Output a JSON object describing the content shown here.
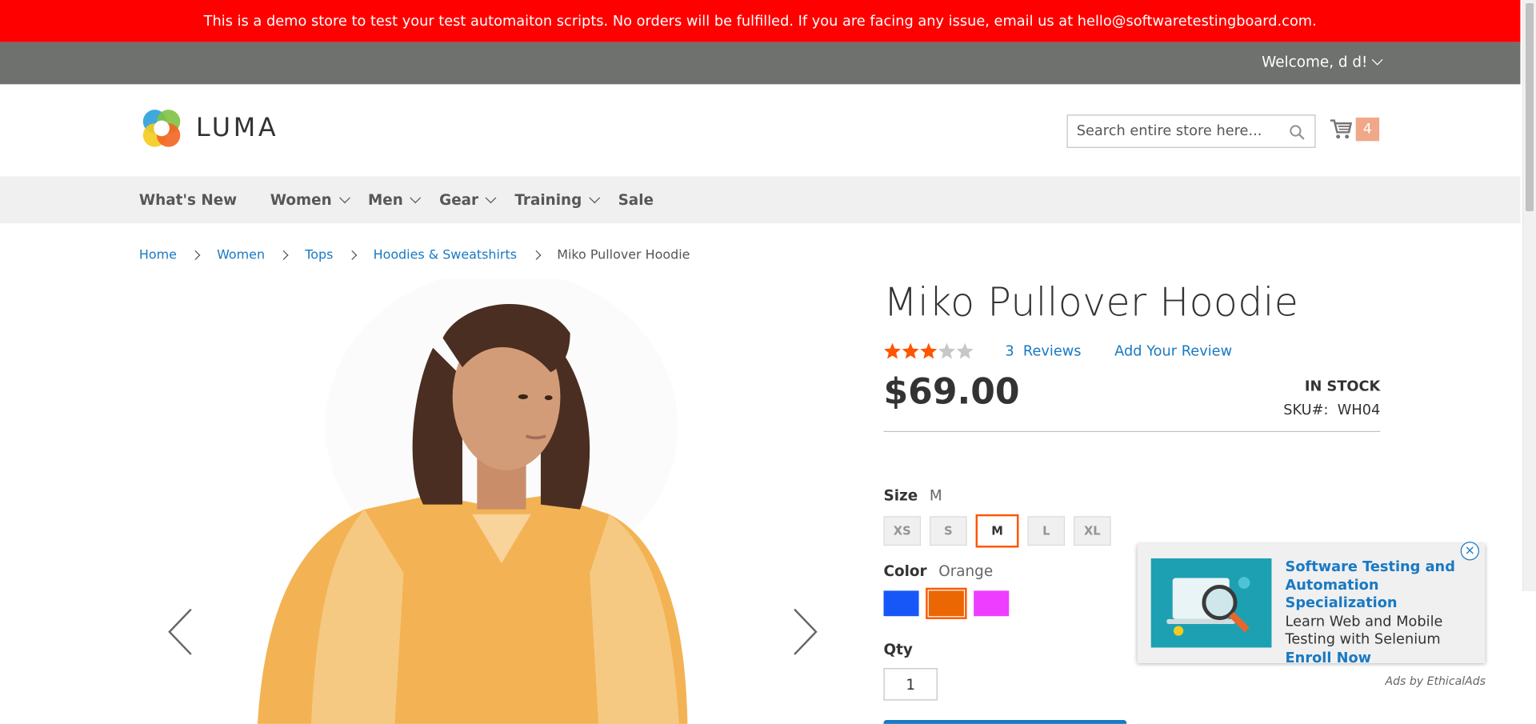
{
  "demo_notice": "This is a demo store to test your test automaiton scripts. No orders will be fulfilled. If you are facing any issue, email us at hello@softwaretestingboard.com.",
  "header": {
    "welcome": "Welcome, d d!",
    "logo_text": "LUMA",
    "search_placeholder": "Search entire store here...",
    "cart_count": "4"
  },
  "nav": {
    "items": [
      {
        "label": "What's New"
      },
      {
        "label": "Women"
      },
      {
        "label": "Men"
      },
      {
        "label": "Gear"
      },
      {
        "label": "Training"
      },
      {
        "label": "Sale"
      }
    ]
  },
  "breadcrumbs": [
    "Home",
    "Women",
    "Tops",
    "Hoodies & Sweatshirts",
    "Miko Pullover Hoodie"
  ],
  "product": {
    "title": "Miko Pullover Hoodie",
    "rating": 3,
    "rating_max": 5,
    "reviews_count": "3",
    "reviews_label": "Reviews",
    "add_review": "Add Your Review",
    "price": "$69.00",
    "stock": "IN STOCK",
    "sku_label": "SKU#:",
    "sku": "WH04",
    "size_label": "Size",
    "size_selected": "M",
    "sizes": [
      "XS",
      "S",
      "M",
      "L",
      "XL"
    ],
    "color_label": "Color",
    "color_selected": "Orange",
    "colors": [
      {
        "name": "Blue",
        "hex": "#1857f7"
      },
      {
        "name": "Orange",
        "hex": "#eb6703"
      },
      {
        "name": "Purple",
        "hex": "#ef3dff"
      }
    ],
    "qty_label": "Qty",
    "qty": "1"
  },
  "ad": {
    "title": "Software Testing and Automation Specialization",
    "body": "Learn Web and Mobile Testing with Selenium",
    "cta": "Enroll Now",
    "close": "×",
    "by": "Ads by EthicalAds"
  },
  "colors": {
    "accent": "#1979c3",
    "notice_red": "#ff0000",
    "selected_border": "#ff5501",
    "star": "#ff5501"
  }
}
